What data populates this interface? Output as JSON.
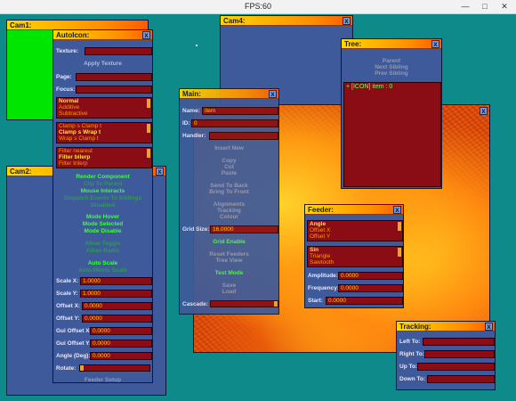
{
  "app": {
    "fps_label": "FPS:60"
  },
  "cam1": {
    "title": "Cam1:"
  },
  "cam2": {
    "title": "Cam2:"
  },
  "cam4": {
    "title": "Cam4:"
  },
  "autoicon": {
    "title": "AutoIcon:",
    "texture_label": "Texture:",
    "apply_texture": "Apply Texture",
    "page_label": "Page:",
    "focus_label": "Focus:",
    "blend_modes": [
      "Normal",
      "Additive",
      "Subtractive"
    ],
    "clamp_modes": [
      "Clamp s Clamp t",
      "Clamp s Wrap t",
      "Wrap s Clamp t"
    ],
    "filters": [
      "Filter nearest",
      "Filter bilerp",
      "Filter trilerp"
    ],
    "buttons": {
      "render_component": "Render Component",
      "clip_to_parent": "Clip To Parent",
      "mouse_interacts": "Mouse Interacts",
      "dispatch_events": "Dispatch Events To Siblings",
      "disabled": "Disabled",
      "mode_hover": "Mode Hover",
      "mode_selected": "Mode Selected",
      "mode_disable": "Mode Disable",
      "allow_toggle": "Allow Toggle",
      "allow_radio": "Allow Radio",
      "auto_scale": "Auto Scale",
      "auto_metric_scale": "Auto Metric Scale",
      "feeder_setup": "Feeder Setup"
    },
    "scale_x_label": "Scale X:",
    "scale_x": "1.0000",
    "scale_y_label": "Scale Y:",
    "scale_y": "1.0000",
    "offset_x_label": "Offset X:",
    "offset_x": "0.0000",
    "offset_y_label": "Offset Y:",
    "offset_y": "0.0000",
    "gui_offset_x_label": "Gui Offset X:",
    "gui_offset_x": "0.0000",
    "gui_offset_y_label": "Gui Offset Y:",
    "gui_offset_y": "0.0000",
    "angle_label": "Angle (Deg):",
    "angle": "0.0000",
    "rotate_label": "Rotate:"
  },
  "main": {
    "title": "Main:",
    "name_label": "Name:",
    "name_value": "item",
    "id_label": "ID:",
    "id_value": "0",
    "handler_label": "Handler:",
    "handler_value": "",
    "insert_new": "Insert New",
    "copy": "Copy",
    "cut": "Cut",
    "paste": "Paste",
    "send_to_back": "Send To Back",
    "bring_to_front": "Bring To Front",
    "alignments": "Alignments",
    "tracking": "Tracking",
    "colour": "Colour",
    "grid_size_label": "Grid Size:",
    "grid_size": "16.0000",
    "grid_enable": "Grid Enable",
    "reset_feeders": "Reset Feeders",
    "tree_view": "Tree View",
    "test_mode": "Test Mode",
    "save": "Save",
    "load": "Load",
    "cascade_label": "Cascade:"
  },
  "tree": {
    "title": "Tree:",
    "parent": "Parent",
    "next_sibling": "Next Sibling",
    "prev_sibling": "Prev Sibling",
    "item": "+ [ICON] item : 0"
  },
  "feeder": {
    "title": "Feeder:",
    "channels": [
      "Angle",
      "Offset X",
      "Offset Y"
    ],
    "waves": [
      "Sin",
      "Triangle",
      "Sawtooth"
    ],
    "amplitude_label": "Amplitude:",
    "amplitude": "0.0000",
    "frequency_label": "Frequency:",
    "frequency": "0.0000",
    "start_label": "Start:",
    "start": "0.0000"
  },
  "tracking": {
    "title": "Tracking:",
    "left_label": "Left To:",
    "right_label": "Right To:",
    "up_label": "Up To:",
    "down_label": "Down To:"
  },
  "colors": {
    "desktop": "#0e8a8a",
    "panel": "#3e5a9a",
    "field": "#8a0c14",
    "accent": "#ffd000"
  }
}
